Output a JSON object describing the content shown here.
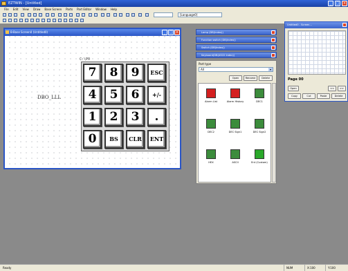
{
  "app": {
    "title": "EZTWIN - [Untitled]",
    "minimize": "_",
    "maximize": "□",
    "close": "×"
  },
  "menu": [
    "File",
    "Edit",
    "View",
    "Draw",
    "Base Screen",
    "Parts",
    "Part Editor",
    "Window",
    "Help"
  ],
  "toolbar": {
    "combo1_value": "",
    "combo2_value": "[Language0]"
  },
  "document": {
    "title": "B-Base Screen0 (Untitled0)",
    "keypad_label": "C:\\P0",
    "dbo_label": "DBO_LLL",
    "keys": [
      [
        "7",
        "8",
        "9",
        "ESC"
      ],
      [
        "4",
        "5",
        "6",
        "+/-"
      ],
      [
        "1",
        "2",
        "3",
        "."
      ],
      [
        "0",
        "BS",
        "CLR",
        "ENT"
      ]
    ]
  },
  "panels": [
    "Lamp (DB(Index))",
    "Function switch (DB(Index))",
    "Switch (DB(Index))",
    "Keyboard(DB(ASCII Index))"
  ],
  "parts": {
    "header": "Part type",
    "select_value": "All",
    "buttons": [
      "Open",
      "Rename",
      "Delete"
    ],
    "items": [
      {
        "label": "Alarm List",
        "icon": "alarm-list-icon",
        "color": "#d42020"
      },
      {
        "label": "Alarm History",
        "icon": "alarm-history-icon",
        "color": "#d42020"
      },
      {
        "label": "DEC1",
        "icon": "dec1-icon",
        "color": "#3c8c3c"
      },
      {
        "label": "DEC2",
        "icon": "dec2-icon",
        "color": "#3c8c3c"
      },
      {
        "label": "DEC Sign1",
        "icon": "dec-sign1-icon",
        "color": "#3c8c3c"
      },
      {
        "label": "DEC Sign2",
        "icon": "dec-sign2-icon",
        "color": "#3c8c3c"
      },
      {
        "label": "HEX",
        "icon": "hex-icon",
        "color": "#3c8c3c"
      },
      {
        "label": "ASCII",
        "icon": "ascii-icon",
        "color": "#3c8c3c"
      },
      {
        "label": "Ent (Custom)",
        "icon": "ent-custom-icon",
        "color": "#2aa82a"
      }
    ]
  },
  "page_window": {
    "title": "Untitled0 - Screen...",
    "page_label": "Page 00",
    "buttons_row1": [
      "Open",
      "<<",
      ">>"
    ],
    "buttons_row2": [
      "Copy",
      "Cut",
      "Paste",
      "Delete"
    ]
  },
  "status": {
    "left": "Ready",
    "mode": "NUM",
    "coords": "X:100",
    "coords2": "Y:100"
  }
}
